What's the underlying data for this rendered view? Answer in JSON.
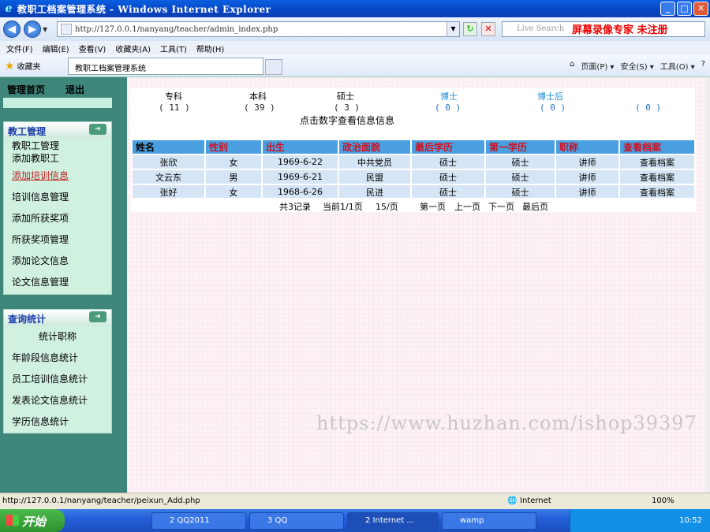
{
  "window": {
    "title": "教职工档案管理系统 - Windows Internet Explorer",
    "minimize": "_",
    "maximize": "□",
    "close": "✕"
  },
  "address": {
    "url": "http://127.0.0.1/nanyang/teacher/admin_index.php",
    "search_placeholder": "Live Search",
    "overlay_text": "屏幕录像专家 未注册"
  },
  "menu": [
    "文件(F)",
    "编辑(E)",
    "查看(V)",
    "收藏夹(A)",
    "工具(T)",
    "帮助(H)"
  ],
  "favbar": {
    "favorites": "收藏夹",
    "tab_title": "教职工档案管理系统",
    "tools": [
      "页面(P) ▾",
      "安全(S) ▾",
      "工具(O) ▾"
    ]
  },
  "sidebar": {
    "home": "管理首页",
    "logout": "退出",
    "staff_panel": {
      "title": "教工管理",
      "items": [
        "教职工管理",
        "添加教职工",
        "添加培训信息",
        "培训信息管理",
        "添加所获奖项",
        "所获奖项管理",
        "添加论文信息",
        "论文信息管理"
      ]
    },
    "query_panel": {
      "title": "查询统计",
      "items": [
        "统计职称",
        "年龄段信息统计",
        "员工培训信息统计",
        "发表论文信息统计",
        "学历信息统计"
      ]
    }
  },
  "stats": {
    "labels": [
      "专科",
      "本科",
      "硕士",
      "博士",
      "博士后"
    ],
    "counts": [
      "( 11 )",
      "( 39 )",
      "( 3 )",
      "( 0 )",
      "( 0 )",
      "( 0 )"
    ],
    "hint": "点击数字查看信息信息"
  },
  "table": {
    "headers": [
      "姓名",
      "性别",
      "出生",
      "政治面貌",
      "最后学历",
      "第一学历",
      "职称",
      "查看档案"
    ],
    "rows": [
      [
        "张欣",
        "女",
        "1969-6-22",
        "中共党员",
        "硕士",
        "硕士",
        "讲师",
        "查看档案"
      ],
      [
        "文云东",
        "男",
        "1969-6-21",
        "民盟",
        "硕士",
        "硕士",
        "讲师",
        "查看档案"
      ],
      [
        "张好",
        "女",
        "1968-6-26",
        "民进",
        "硕士",
        "硕士",
        "讲师",
        "查看档案"
      ]
    ]
  },
  "pager": {
    "total": "共3记录",
    "current": "当前1/1页",
    "per_page": "15/页",
    "first": "第一页",
    "prev": "上一页",
    "next": "下一页",
    "last": "最后页"
  },
  "watermark": "https://www.huzhan.com/ishop39397",
  "statusbar": {
    "url": "http://127.0.0.1/nanyang/teacher/peixun_Add.php",
    "zone": "Internet",
    "zoom": "100%"
  },
  "taskbar": {
    "start": "开始",
    "items": [
      "2 QQ2011",
      "3 QQ",
      "2 Internet ...",
      "wamp"
    ],
    "clock": "10:52"
  }
}
